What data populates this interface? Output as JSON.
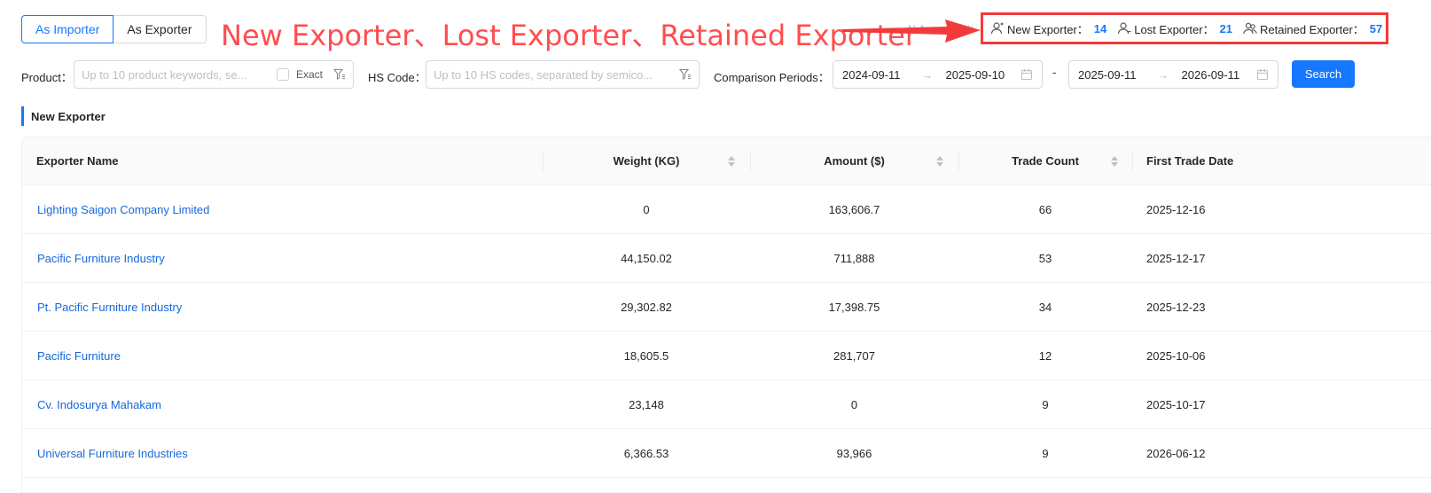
{
  "role_toggle": {
    "importer": "As Importer",
    "exporter": "As Exporter"
  },
  "annotation": {
    "text": "New Exporter、Lost Exporter、Retained Exporter"
  },
  "hidden_select": {
    "value": "N.A."
  },
  "stats": {
    "new_label": "New Exporter：",
    "new_value": "14",
    "lost_label": "Lost Exporter：",
    "lost_value": "21",
    "retained_label": "Retained Exporter：",
    "retained_value": "57"
  },
  "filters": {
    "product_label": "Product：",
    "product_placeholder": "Up to 10 product keywords, se...",
    "exact_label": "Exact",
    "hs_label": "HS Code：",
    "hs_placeholder": "Up to 10 HS codes, separated by semico...",
    "periods_label": "Comparison Periods：",
    "period1_start": "2024-09-11",
    "period1_end": "2025-09-10",
    "dash": "-",
    "period2_start": "2025-09-11",
    "period2_end": "2026-09-11",
    "search_label": "Search"
  },
  "section": {
    "title": "New Exporter"
  },
  "table": {
    "columns": {
      "name": "Exporter Name",
      "weight": "Weight (KG)",
      "amount": "Amount ($)",
      "count": "Trade Count",
      "date": "First Trade Date"
    },
    "rows": [
      {
        "name": "Lighting Saigon Company Limited",
        "weight": "0",
        "amount": "163,606.7",
        "count": "66",
        "date": "2025-12-16"
      },
      {
        "name": "Pacific Furniture Industry",
        "weight": "44,150.02",
        "amount": "711,888",
        "count": "53",
        "date": "2025-12-17"
      },
      {
        "name": "Pt. Pacific Furniture Industry",
        "weight": "29,302.82",
        "amount": "17,398.75",
        "count": "34",
        "date": "2025-12-23"
      },
      {
        "name": "Pacific Furniture",
        "weight": "18,605.5",
        "amount": "281,707",
        "count": "12",
        "date": "2025-10-06"
      },
      {
        "name": "Cv. Indosurya Mahakam",
        "weight": "23,148",
        "amount": "0",
        "count": "9",
        "date": "2025-10-17"
      },
      {
        "name": "Universal Furniture Industries",
        "weight": "6,366.53",
        "amount": "93,966",
        "count": "9",
        "date": "2026-06-12"
      }
    ]
  },
  "colors": {
    "accent": "#1677ff",
    "annotation": "#ff4d4f",
    "highlight_border": "#f33a3a"
  },
  "icons": [
    "user-plus-icon",
    "user-minus-icon",
    "users-icon",
    "filter-icon",
    "calendar-icon",
    "sort-icon",
    "arrow-right-icon"
  ]
}
